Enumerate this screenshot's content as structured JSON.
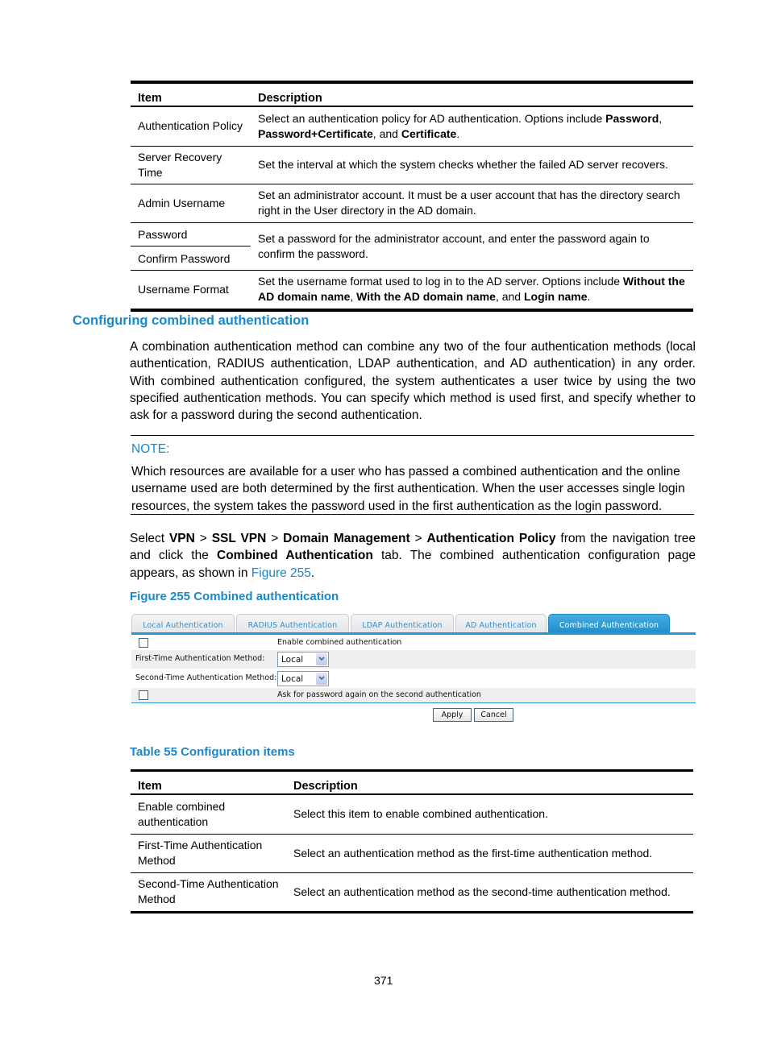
{
  "ad_table": {
    "headers": [
      "Item",
      "Description"
    ],
    "rows": [
      {
        "item": "Authentication Policy",
        "desc_parts": [
          "Select an authentication policy for AD authentication. Options include ",
          "Password",
          ", ",
          "Password+Certificate",
          ", and ",
          "Certificate",
          "."
        ]
      },
      {
        "item": "Server Recovery Time",
        "desc": "Set the interval at which the system checks whether the failed AD server recovers."
      },
      {
        "item": "Admin Username",
        "desc": "Set an administrator account. It must be a user account that has the directory search right in the User directory in the AD domain."
      },
      {
        "item": "Password",
        "item2": "Confirm Password",
        "desc": "Set a password for the administrator account, and enter the password again to confirm the password."
      },
      {
        "item": "Username Format",
        "desc_parts": [
          "Set the username format used to log in to the AD server. Options include ",
          "Without the AD domain name",
          ", ",
          "With the AD domain name",
          ", and ",
          "Login name",
          "."
        ]
      }
    ]
  },
  "section": {
    "heading": "Configuring combined authentication",
    "paragraph": "A combination authentication method can combine any two of the four authentication methods (local authentication, RADIUS authentication, LDAP authentication, and AD authentication) in any order. With combined authentication configured, the system authenticates a user twice by using the two specified authentication methods. You can specify which method is used first, and specify whether to ask for a password during the second authentication."
  },
  "note": {
    "label": "NOTE:",
    "text": "Which resources are available for a user who has passed a combined authentication and the online username used are both determined by the first authentication. When the user accesses single login resources, the system takes the password used in the first authentication as the login password."
  },
  "instruction": {
    "p1": "Select ",
    "b1": "VPN",
    "s1": " > ",
    "b2": "SSL VPN",
    "s2": " > ",
    "b3": "Domain Management",
    "s3": " > ",
    "b4": "Authentication Policy",
    "p2": " from the navigation tree and click the ",
    "b5": "Combined Authentication",
    "p3": " tab. The combined authentication configuration page appears, as shown in ",
    "link": "Figure 255",
    "p4": "."
  },
  "figure": {
    "caption": "Figure 255 Combined authentication",
    "tabs": [
      "Local Authentication",
      "RADIUS Authentication",
      "LDAP Authentication",
      "AD Authentication",
      "Combined Authentication"
    ],
    "active_tab": "Combined Authentication",
    "enable_label": "Enable combined authentication",
    "enable_checked": false,
    "first_method_label": "First-Time Authentication Method:",
    "first_method_value": "Local",
    "second_method_label": "Second-Time Authentication Method:",
    "second_method_value": "Local",
    "ask_password_label": "Ask for password again on the second authentication",
    "ask_password_checked": false,
    "apply_label": "Apply",
    "cancel_label": "Cancel",
    "accent_color": "#2b95d0"
  },
  "config_table": {
    "caption": "Table 55 Configuration items",
    "headers": [
      "Item",
      "Description"
    ],
    "rows": [
      {
        "item": "Enable combined authentication",
        "desc": "Select this item to enable combined authentication."
      },
      {
        "item": "First-Time Authentication Method",
        "desc": "Select an authentication method as the first-time authentication method."
      },
      {
        "item": "Second-Time Authentication Method",
        "desc": "Select an authentication method as the second-time authentication method."
      }
    ]
  },
  "page_number": "371",
  "colors": {
    "heading_blue": "#1a88c9"
  }
}
